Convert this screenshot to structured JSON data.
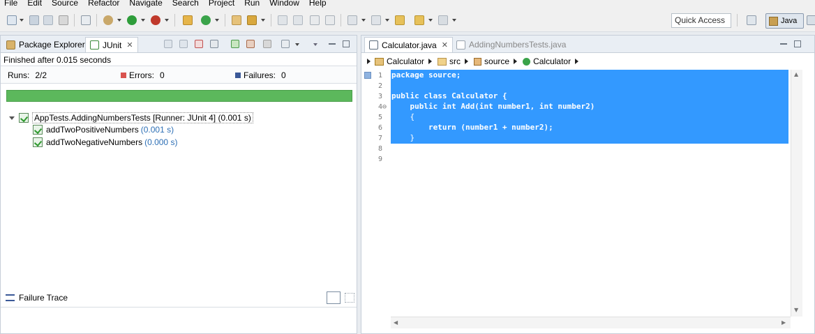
{
  "menu": [
    "File",
    "Edit",
    "Source",
    "Refactor",
    "Navigate",
    "Search",
    "Project",
    "Run",
    "Window",
    "Help"
  ],
  "toolbar": {
    "quick_access": "Quick Access",
    "perspective": "Java"
  },
  "left_panel": {
    "tabs": [
      {
        "label": "Package Explorer"
      },
      {
        "label": "JUnit"
      }
    ],
    "status": "Finished after 0.015 seconds",
    "runs_label": "Runs:",
    "runs_value": "2/2",
    "errors_label": "Errors:",
    "errors_value": "0",
    "failures_label": "Failures:",
    "failures_value": "0",
    "progress": 1.0,
    "suite": {
      "label": "AppTests.AddingNumbersTests [Runner: JUnit 4] (0.001 s)",
      "tests": [
        {
          "name": "addTwoPositiveNumbers",
          "time": "(0.001 s)"
        },
        {
          "name": "addTwoNegativeNumbers",
          "time": "(0.000 s)"
        }
      ]
    },
    "failure_trace": "Failure Trace"
  },
  "editor": {
    "tabs": [
      {
        "label": "Calculator.java"
      },
      {
        "label": "AddingNumbersTests.java"
      }
    ],
    "breadcrumb": [
      "Calculator",
      "src",
      "source",
      "Calculator"
    ],
    "lines": [
      {
        "n": "1",
        "text": "package source;"
      },
      {
        "n": "2",
        "text": ""
      },
      {
        "n": "3",
        "text": "public class Calculator {"
      },
      {
        "n": "4⊖",
        "text": "    public int Add(int number1, int number2)"
      },
      {
        "n": "5",
        "text": "    {"
      },
      {
        "n": "6",
        "text": "        return (number1 + number2);"
      },
      {
        "n": "7",
        "text": "    }"
      },
      {
        "n": "8",
        "text": "}"
      },
      {
        "n": "9",
        "text": ""
      }
    ]
  },
  "colors": {
    "progress_green": "#5cb85c",
    "selection_blue": "#3399ff",
    "time_blue": "#2d6fb5"
  }
}
